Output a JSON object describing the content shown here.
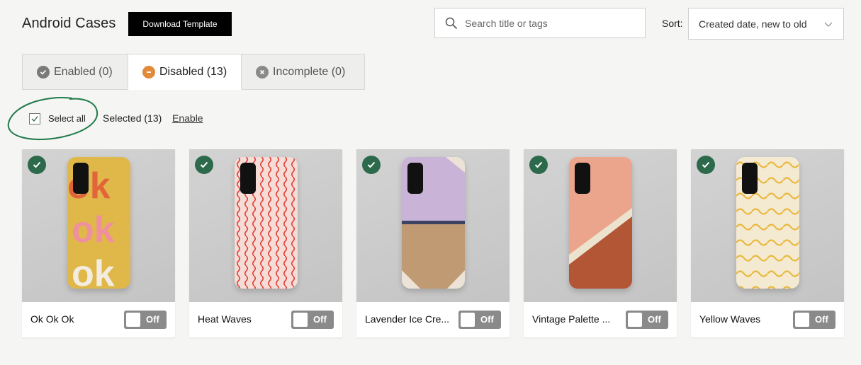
{
  "header": {
    "title": "Android Cases",
    "download_button": "Download Template",
    "search_placeholder": "Search title or tags",
    "sort_label": "Sort:",
    "sort_value": "Created date, new to old"
  },
  "tabs": [
    {
      "label": "Enabled (0)",
      "active": false,
      "icon": "check-circle-icon",
      "color": "#777777"
    },
    {
      "label": "Disabled (13)",
      "active": true,
      "icon": "minus-circle-icon",
      "color": "#e08a3a"
    },
    {
      "label": "Incomplete (0)",
      "active": false,
      "icon": "x-circle-icon",
      "color": "#8a8a8a"
    }
  ],
  "selection": {
    "select_all_label": "Select all",
    "select_all_checked": true,
    "selected_text": "Selected (13)",
    "enable_link": "Enable",
    "annotation_color": "#1f7a4a"
  },
  "products": [
    {
      "name": "Ok Ok Ok",
      "toggle": "Off",
      "selected": true
    },
    {
      "name": "Heat Waves",
      "toggle": "Off",
      "selected": true
    },
    {
      "name": "Lavender Ice Cre...",
      "toggle": "Off",
      "selected": true
    },
    {
      "name": "Vintage Palette ...",
      "toggle": "Off",
      "selected": true
    },
    {
      "name": "Yellow Waves",
      "toggle": "Off",
      "selected": true
    }
  ],
  "colors": {
    "check_badge": "#2d6a4c",
    "toggle_off": "#8a8a8a"
  }
}
